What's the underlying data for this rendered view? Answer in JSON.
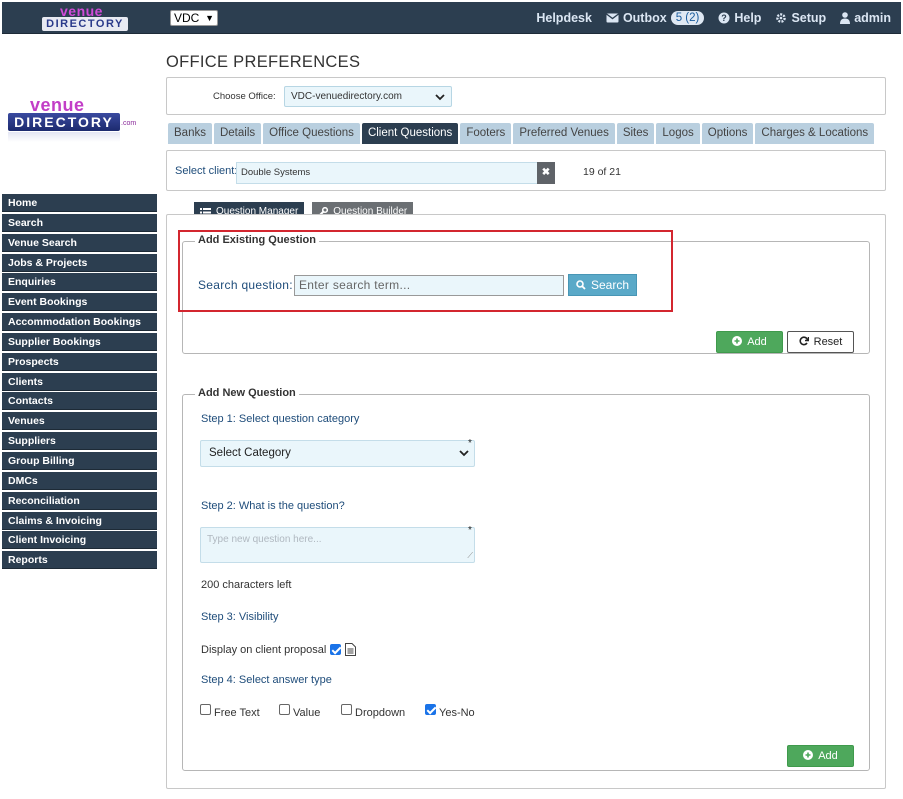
{
  "topbar": {
    "logo_top": "venue",
    "logo_bottom": "DIRECTORY",
    "client_select": "VDC",
    "nav": {
      "helpdesk": "Helpdesk",
      "outbox": "Outbox",
      "outbox_badge": "5 (2)",
      "help": "Help",
      "setup": "Setup",
      "admin": "admin"
    }
  },
  "logo": {
    "top": "venue",
    "bottom": "DIRECTORY",
    "suffix": ".com"
  },
  "sidebar": {
    "items": [
      "Home",
      "Search",
      "Venue Search",
      "Jobs & Projects",
      "Enquiries",
      "Event Bookings",
      "Accommodation Bookings",
      "Supplier Bookings",
      "Prospects",
      "Clients",
      "Contacts",
      "Venues",
      "Suppliers",
      "Group Billing",
      "DMCs",
      "Reconciliation",
      "Claims & Invoicing",
      "Client Invoicing",
      "Reports"
    ]
  },
  "page": {
    "title": "OFFICE PREFERENCES",
    "choose_office_label": "Choose Office:",
    "office_value": "VDC-venuedirectory.com",
    "tabs": [
      "Banks",
      "Details",
      "Office Questions",
      "Client Questions",
      "Footers",
      "Preferred Venues",
      "Sites",
      "Logos",
      "Options",
      "Charges & Locations"
    ],
    "active_tab": "Client Questions",
    "select_client_label": "Select client:",
    "client_value": "Double Systems",
    "clear_glyph": "✖",
    "counter": "19 of 21"
  },
  "subtabs": {
    "manager": "Question Manager",
    "builder": "Question Builder"
  },
  "existing": {
    "legend": "Add Existing Question",
    "search_label": "Search question:",
    "search_placeholder": "Enter search term...",
    "search_button": "Search",
    "add_button": "Add",
    "reset_button": "Reset"
  },
  "new_question": {
    "legend": "Add New Question",
    "step1": "Step 1: Select question category",
    "category_value": "Select Category",
    "step2": "Step 2: What is the question?",
    "question_placeholder": "Type new question here...",
    "chars_left": "200 characters left",
    "step3": "Step 3: Visibility",
    "display_label": "Display on client proposal",
    "display_checked": true,
    "step4": "Step 4: Select answer type",
    "answer_types": [
      {
        "label": "Free Text",
        "checked": false
      },
      {
        "label": "Value",
        "checked": false
      },
      {
        "label": "Dropdown",
        "checked": false
      },
      {
        "label": "Yes-No",
        "checked": true
      }
    ],
    "add_button": "Add",
    "required_mark": "*"
  },
  "colors": {
    "navbar": "#2c3e50",
    "tab_inactive": "#b9cfdf",
    "input_bg": "#eaf6fb",
    "add_green": "#4ea85c",
    "search_blue": "#5aa9c8",
    "highlight_red": "#d3262f",
    "label_blue": "#1e4c7a"
  }
}
